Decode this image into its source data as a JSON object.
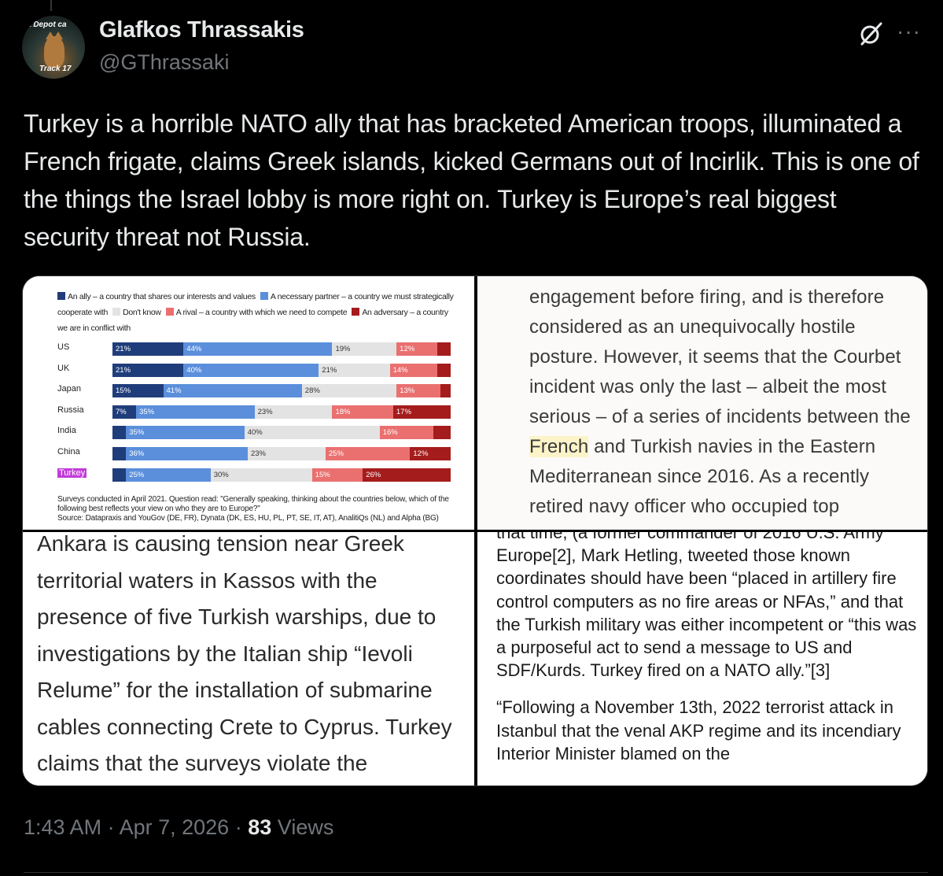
{
  "author": {
    "name": "Glafkos Thrassakis",
    "handle": "@GThrassaki",
    "avatar_text_top": "a Depot ca",
    "avatar_text_bottom": "Track 17"
  },
  "header_icons": [
    "grok-icon",
    "more-icon"
  ],
  "more_label": "···",
  "tweet_text": "Turkey is a horrible NATO ally that has bracketed American troops, illuminated a French frigate, claims Greek islands, kicked Germans out of Incirlik. This is one of the things the Israel lobby is more right on. Turkey is Europe’s real biggest security threat not Russia.",
  "media": {
    "chart": {
      "legend": [
        {
          "color": "#1f3d7a",
          "text": "An ally – a country that shares our interests and values"
        },
        {
          "color": "#5b8fdc",
          "text": "A necessary partner – a country we must strategically cooperate with"
        },
        {
          "color": "#e3e3e3",
          "text": "Don't know"
        },
        {
          "color": "#ea7070",
          "text": "A rival – a country with which we need to compete"
        },
        {
          "color": "#a51c1c",
          "text": "An adversary – a country we are in conflict with"
        }
      ],
      "footnote": "Surveys conducted in April 2021. Question read: \"Generally speaking, thinking about the countries below, which of the following best reflects your view on who they are to Europe?\"",
      "source": "Source: Datapraxis and YouGov (DE, FR), Dynata (DK, ES, HU, PL, PT, SE, IT, AT), AnalitiQs (NL) and Alpha (BG)"
    },
    "chart_data": {
      "type": "bar",
      "stacked": true,
      "orientation": "horizontal",
      "categories": [
        "US",
        "UK",
        "Japan",
        "Russia",
        "India",
        "China",
        "Turkey"
      ],
      "series": [
        {
          "name": "An ally – a country that shares our interests and values",
          "color": "#1f3d7a",
          "values": [
            21,
            21,
            15,
            7,
            4,
            4,
            4
          ],
          "labels": [
            "21%",
            "21%",
            "15%",
            "7%",
            "",
            "",
            ""
          ]
        },
        {
          "name": "A necessary partner – a country we must strategically cooperate with",
          "color": "#5b8fdc",
          "values": [
            44,
            40,
            41,
            35,
            35,
            36,
            25
          ],
          "labels": [
            "44%",
            "40%",
            "41%",
            "35%",
            "35%",
            "36%",
            "25%"
          ]
        },
        {
          "name": "Don't know",
          "color": "#e3e3e3",
          "values": [
            19,
            21,
            28,
            23,
            40,
            23,
            30
          ],
          "labels": [
            "19%",
            "21%",
            "28%",
            "23%",
            "40%",
            "23%",
            "30%"
          ]
        },
        {
          "name": "A rival – a country with which we need to compete",
          "color": "#ea7070",
          "values": [
            12,
            14,
            13,
            18,
            16,
            25,
            15
          ],
          "labels": [
            "12%",
            "14%",
            "13%",
            "18%",
            "16%",
            "25%",
            "15%"
          ]
        },
        {
          "name": "An adversary – a country we are in conflict with",
          "color": "#a51c1c",
          "values": [
            4,
            4,
            3,
            17,
            5,
            12,
            26
          ],
          "labels": [
            "",
            "",
            "",
            "17%",
            "",
            "12%",
            "26%"
          ]
        }
      ],
      "highlight_category": "Turkey",
      "xlim": [
        0,
        100
      ]
    },
    "excerpt_top_right": {
      "before": "engagement before firing, and is therefore considered as an unequivocally hostile posture. However, it seems that the Courbet incident was only the last – albeit the most serious – of a series of incidents between the ",
      "highlight": "French",
      "after": " and Turkish navies in the Eastern Mediterranean since 2016. As a recently retired navy officer who occupied top"
    },
    "excerpt_bottom_left": "Ankara is causing tension near Greek territorial waters in Kassos with the presence of five Turkish warships, due to investigations by the Italian ship “Ievoli Relume” for the installation of submarine cables connecting Crete to Cyprus. Turkey claims that the surveys violate the",
    "excerpt_bottom_right_p1": "that time, (a former commander of 2016 U.S. Army Europe[2], Mark Hetling, tweeted those known coordinates should have been “placed in artillery fire control computers as no fire areas or NFAs,” and that the Turkish military was either incompetent or “this was a purposeful act to send a message to US and SDF/Kurds. Turkey fired on a NATO ally.”[3]",
    "excerpt_bottom_right_p2": "“Following a November 13th, 2022 terrorist attack in Istanbul that the venal AKP regime and its incendiary Interior Minister blamed on the"
  },
  "meta": {
    "time": "1:43 AM",
    "date": "Apr 7, 2026",
    "separator": "·",
    "views_count": "83",
    "views_label": "Views"
  }
}
